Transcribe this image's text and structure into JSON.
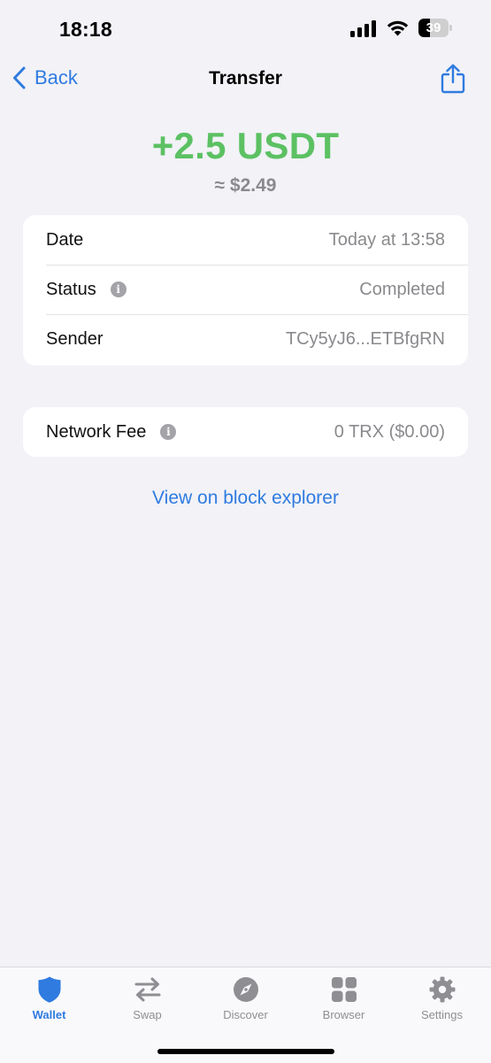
{
  "status_bar": {
    "time": "18:18",
    "battery_level": "39",
    "battery_fraction": 0.39
  },
  "nav": {
    "back_label": "Back",
    "title": "Transfer"
  },
  "amount": {
    "value": "+2.5 USDT",
    "fiat": "≈ $2.49",
    "color": "#5CC163"
  },
  "details": {
    "rows": [
      {
        "label": "Date",
        "value": "Today at 13:58"
      },
      {
        "label": "Status",
        "value": "Completed"
      },
      {
        "label": "Sender",
        "value": "TCy5yJ6...ETBfgRN"
      }
    ]
  },
  "fee": {
    "label": "Network Fee",
    "value": "0 TRX ($0.00)"
  },
  "explorer_link": "View on block explorer",
  "tabs": [
    {
      "label": "Wallet",
      "icon": "shield-icon",
      "active": true
    },
    {
      "label": "Swap",
      "icon": "swap-arrows-icon",
      "active": false
    },
    {
      "label": "Discover",
      "icon": "compass-icon",
      "active": false
    },
    {
      "label": "Browser",
      "icon": "grid-icon",
      "active": false
    },
    {
      "label": "Settings",
      "icon": "gear-icon",
      "active": false
    }
  ],
  "colors": {
    "accent": "#2F7BE0",
    "positive": "#5CC163",
    "secondary_text": "#8A8A8E",
    "background": "#F2F2F7"
  }
}
